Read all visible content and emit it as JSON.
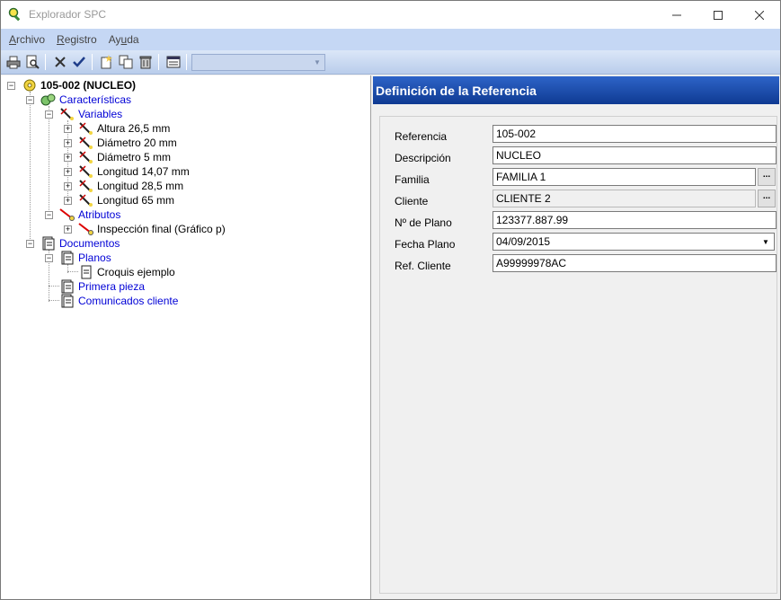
{
  "window": {
    "title": "Explorador SPC",
    "minimize": "—",
    "maximize": "☐",
    "close": "✕"
  },
  "menu": [
    {
      "hotkey": "A",
      "rest": "rchivo"
    },
    {
      "hotkey": "R",
      "rest": "egistro"
    },
    {
      "prefix": "Ay",
      "hotkey": "u",
      "rest": "da"
    }
  ],
  "toolbar": {
    "combo_value": ""
  },
  "tree": {
    "root": "105-002 (NUCLEO)",
    "caracteristicas": "Características",
    "variables": "Variables",
    "variable_items": [
      "Altura 26,5 mm",
      "Diámetro 20 mm",
      "Diámetro 5 mm",
      "Longitud 14,07 mm",
      "Longitud 28,5 mm",
      "Longitud 65 mm"
    ],
    "atributos": "Atributos",
    "atributo_items": [
      "Inspección final (Gráfico p)"
    ],
    "documentos": "Documentos",
    "planos": "Planos",
    "plano_items": [
      "Croquis ejemplo"
    ],
    "primera_pieza": "Primera pieza",
    "comunicados": "Comunicados cliente"
  },
  "panel": {
    "header": "Definición de la Referencia",
    "fields": {
      "referencia": {
        "label": "Referencia",
        "value": "105-002"
      },
      "descripcion": {
        "label": "Descripción",
        "value": "NUCLEO"
      },
      "familia": {
        "label": "Familia",
        "value": "FAMILIA 1"
      },
      "cliente": {
        "label": "Cliente",
        "value": "CLIENTE 2"
      },
      "plano": {
        "label": "Nº de Plano",
        "value": "123377.887.99"
      },
      "fecha": {
        "label": "Fecha Plano",
        "value": "04/09/2015"
      },
      "ref_cliente": {
        "label": "Ref. Cliente",
        "value": "A99999978AC"
      }
    },
    "ellipsis": "..."
  },
  "colors": {
    "header_start": "#2d64c8",
    "header_end": "#0f3a92",
    "link_blue": "#0000d6",
    "menubar": "#c5d7f4"
  }
}
